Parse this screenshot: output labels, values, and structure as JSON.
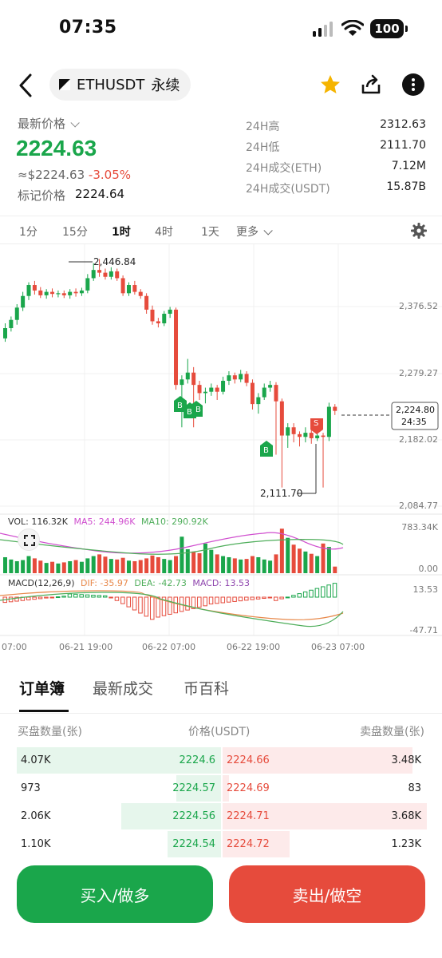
{
  "status_bar": {
    "time": "07:35",
    "battery": "100"
  },
  "header": {
    "pair": "ETHUSDT",
    "contract": "永续"
  },
  "price": {
    "latest_label": "最新价格",
    "last": "2224.63",
    "approx": "≈$2224.63",
    "change": "-3.05%",
    "mark_label": "标记价格",
    "mark": "2224.64"
  },
  "stats": [
    {
      "label": "24H高",
      "value": "2312.63"
    },
    {
      "label": "24H低",
      "value": "2111.70"
    },
    {
      "label": "24H成交(ETH)",
      "value": "7.12M"
    },
    {
      "label": "24H成交(USDT)",
      "value": "15.87B"
    }
  ],
  "timeframes": [
    "1分",
    "15分",
    "1时",
    "4时",
    "1天",
    "更多"
  ],
  "active_timeframe": "1时",
  "chart_data": {
    "type": "candlestick",
    "price_axis_ticks": [
      "2,376.52",
      "2,279.27",
      "2,182.02",
      "2,084.77"
    ],
    "high_label": "2,446.84",
    "low_label": "2,111.70",
    "current_price_label": "2,224.80",
    "countdown": "24:35",
    "markers": [
      "B",
      "B",
      "B",
      "B",
      "S"
    ],
    "volume": {
      "vol": "VOL: 116.32K",
      "ma5": "MA5: 244.96K",
      "ma10": "MA10: 290.92K",
      "axis_top": "783.34K",
      "axis_bottom": "0.00"
    },
    "macd": {
      "title": "MACD(12,26,9)",
      "dif": "DIF: -35.97",
      "dea": "DEA: -42.73",
      "macd": "MACD: 13.53",
      "axis_top": "13.53",
      "axis_bottom": "-47.71"
    },
    "time_labels": [
      "07:00",
      "06-21 19:00",
      "06-22 07:00",
      "06-22 19:00",
      "06-23 07:00"
    ],
    "candles": [
      {
        "o": 2330,
        "c": 2345,
        "h": 2352,
        "l": 2325
      },
      {
        "o": 2345,
        "c": 2357,
        "h": 2362,
        "l": 2340
      },
      {
        "o": 2357,
        "c": 2375,
        "h": 2380,
        "l": 2350
      },
      {
        "o": 2375,
        "c": 2392,
        "h": 2398,
        "l": 2370
      },
      {
        "o": 2392,
        "c": 2408,
        "h": 2412,
        "l": 2386
      },
      {
        "o": 2408,
        "c": 2400,
        "h": 2414,
        "l": 2394
      },
      {
        "o": 2400,
        "c": 2393,
        "h": 2405,
        "l": 2389
      },
      {
        "o": 2393,
        "c": 2398,
        "h": 2402,
        "l": 2388
      },
      {
        "o": 2398,
        "c": 2395,
        "h": 2403,
        "l": 2390
      },
      {
        "o": 2395,
        "c": 2396,
        "h": 2400,
        "l": 2390
      },
      {
        "o": 2396,
        "c": 2393,
        "h": 2400,
        "l": 2389
      },
      {
        "o": 2393,
        "c": 2398,
        "h": 2402,
        "l": 2388
      },
      {
        "o": 2398,
        "c": 2396,
        "h": 2403,
        "l": 2391
      },
      {
        "o": 2396,
        "c": 2400,
        "h": 2404,
        "l": 2392
      },
      {
        "o": 2400,
        "c": 2418,
        "h": 2424,
        "l": 2396
      },
      {
        "o": 2418,
        "c": 2430,
        "h": 2440,
        "l": 2414
      },
      {
        "o": 2430,
        "c": 2426,
        "h": 2446,
        "l": 2420
      },
      {
        "o": 2426,
        "c": 2420,
        "h": 2432,
        "l": 2416
      },
      {
        "o": 2420,
        "c": 2428,
        "h": 2434,
        "l": 2416
      },
      {
        "o": 2428,
        "c": 2418,
        "h": 2432,
        "l": 2414
      },
      {
        "o": 2418,
        "c": 2396,
        "h": 2422,
        "l": 2392
      },
      {
        "o": 2396,
        "c": 2408,
        "h": 2412,
        "l": 2392
      },
      {
        "o": 2408,
        "c": 2398,
        "h": 2414,
        "l": 2394
      },
      {
        "o": 2398,
        "c": 2392,
        "h": 2402,
        "l": 2388
      },
      {
        "o": 2392,
        "c": 2372,
        "h": 2396,
        "l": 2366
      },
      {
        "o": 2372,
        "c": 2355,
        "h": 2378,
        "l": 2350
      },
      {
        "o": 2355,
        "c": 2352,
        "h": 2360,
        "l": 2346
      },
      {
        "o": 2352,
        "c": 2366,
        "h": 2370,
        "l": 2348
      },
      {
        "o": 2366,
        "c": 2372,
        "h": 2376,
        "l": 2360
      },
      {
        "o": 2372,
        "c": 2262,
        "h": 2375,
        "l": 2255
      },
      {
        "o": 2262,
        "c": 2270,
        "h": 2276,
        "l": 2200
      },
      {
        "o": 2270,
        "c": 2280,
        "h": 2300,
        "l": 2264
      },
      {
        "o": 2280,
        "c": 2262,
        "h": 2288,
        "l": 2200
      },
      {
        "o": 2262,
        "c": 2250,
        "h": 2268,
        "l": 2240
      },
      {
        "o": 2250,
        "c": 2252,
        "h": 2258,
        "l": 2235
      },
      {
        "o": 2252,
        "c": 2258,
        "h": 2264,
        "l": 2246
      },
      {
        "o": 2258,
        "c": 2252,
        "h": 2262,
        "l": 2240
      },
      {
        "o": 2252,
        "c": 2268,
        "h": 2274,
        "l": 2248
      },
      {
        "o": 2268,
        "c": 2276,
        "h": 2282,
        "l": 2262
      },
      {
        "o": 2276,
        "c": 2270,
        "h": 2280,
        "l": 2264
      },
      {
        "o": 2270,
        "c": 2278,
        "h": 2284,
        "l": 2266
      },
      {
        "o": 2278,
        "c": 2265,
        "h": 2282,
        "l": 2260
      },
      {
        "o": 2265,
        "c": 2234,
        "h": 2270,
        "l": 2226
      },
      {
        "o": 2234,
        "c": 2244,
        "h": 2250,
        "l": 2220
      },
      {
        "o": 2244,
        "c": 2258,
        "h": 2264,
        "l": 2240
      },
      {
        "o": 2258,
        "c": 2262,
        "h": 2268,
        "l": 2252
      },
      {
        "o": 2262,
        "c": 2238,
        "h": 2266,
        "l": 2160
      },
      {
        "o": 2238,
        "c": 2188,
        "h": 2242,
        "l": 2112
      },
      {
        "o": 2188,
        "c": 2200,
        "h": 2206,
        "l": 2170
      },
      {
        "o": 2200,
        "c": 2190,
        "h": 2206,
        "l": 2178
      },
      {
        "o": 2190,
        "c": 2186,
        "h": 2194,
        "l": 2172
      },
      {
        "o": 2186,
        "c": 2192,
        "h": 2200,
        "l": 2178
      },
      {
        "o": 2192,
        "c": 2184,
        "h": 2198,
        "l": 2176
      },
      {
        "o": 2184,
        "c": 2188,
        "h": 2196,
        "l": 2180
      },
      {
        "o": 2188,
        "c": 2186,
        "h": 2192,
        "l": 2112
      },
      {
        "o": 2186,
        "c": 2230,
        "h": 2236,
        "l": 2180
      },
      {
        "o": 2230,
        "c": 2224,
        "h": 2234,
        "l": 2218
      }
    ],
    "volumes": [
      280,
      240,
      210,
      230,
      300,
      260,
      220,
      180,
      200,
      170,
      190,
      210,
      230,
      200,
      260,
      300,
      330,
      290,
      250,
      240,
      270,
      220,
      210,
      230,
      260,
      310,
      280,
      250,
      230,
      300,
      640,
      420,
      380,
      350,
      520,
      410,
      330,
      300,
      280,
      260,
      240,
      250,
      300,
      280,
      240,
      220,
      330,
      780,
      620,
      500,
      430,
      380,
      340,
      300,
      520,
      460,
      116
    ],
    "volume_up": [
      true,
      true,
      true,
      true,
      true,
      false,
      false,
      true,
      false,
      true,
      false,
      true,
      false,
      true,
      true,
      true,
      false,
      false,
      true,
      false,
      false,
      true,
      false,
      false,
      false,
      false,
      false,
      true,
      true,
      false,
      true,
      true,
      false,
      false,
      true,
      true,
      false,
      true,
      true,
      false,
      true,
      false,
      false,
      true,
      true,
      true,
      false,
      false,
      true,
      false,
      false,
      true,
      false,
      true,
      false,
      true,
      false
    ]
  },
  "tabs": [
    "订单簿",
    "最新成交",
    "币百科"
  ],
  "orderbook": {
    "headers": {
      "bid_qty": "买盘数量(张)",
      "price": "价格(USDT)",
      "ask_qty": "卖盘数量(张)"
    },
    "rows": [
      {
        "bid_qty": "4.07K",
        "bid_price": "2224.6",
        "ask_price": "2224.66",
        "ask_qty": "3.48K",
        "bid_depth": 1.0,
        "ask_depth": 0.93
      },
      {
        "bid_qty": "973",
        "bid_price": "2224.57",
        "ask_price": "2224.69",
        "ask_qty": "83",
        "bid_depth": 0.22,
        "ask_depth": 0.03
      },
      {
        "bid_qty": "2.06K",
        "bid_price": "2224.56",
        "ask_price": "2224.71",
        "ask_qty": "3.68K",
        "bid_depth": 0.49,
        "ask_depth": 1.0
      },
      {
        "bid_qty": "1.10K",
        "bid_price": "2224.54",
        "ask_price": "2224.72",
        "ask_qty": "1.23K",
        "bid_depth": 0.26,
        "ask_depth": 0.33
      }
    ]
  },
  "actions": {
    "buy": "买入/做多",
    "sell": "卖出/做空"
  },
  "colors": {
    "up": "#1aa64b",
    "down": "#e64b3c",
    "accent_star": "#f5b400"
  }
}
